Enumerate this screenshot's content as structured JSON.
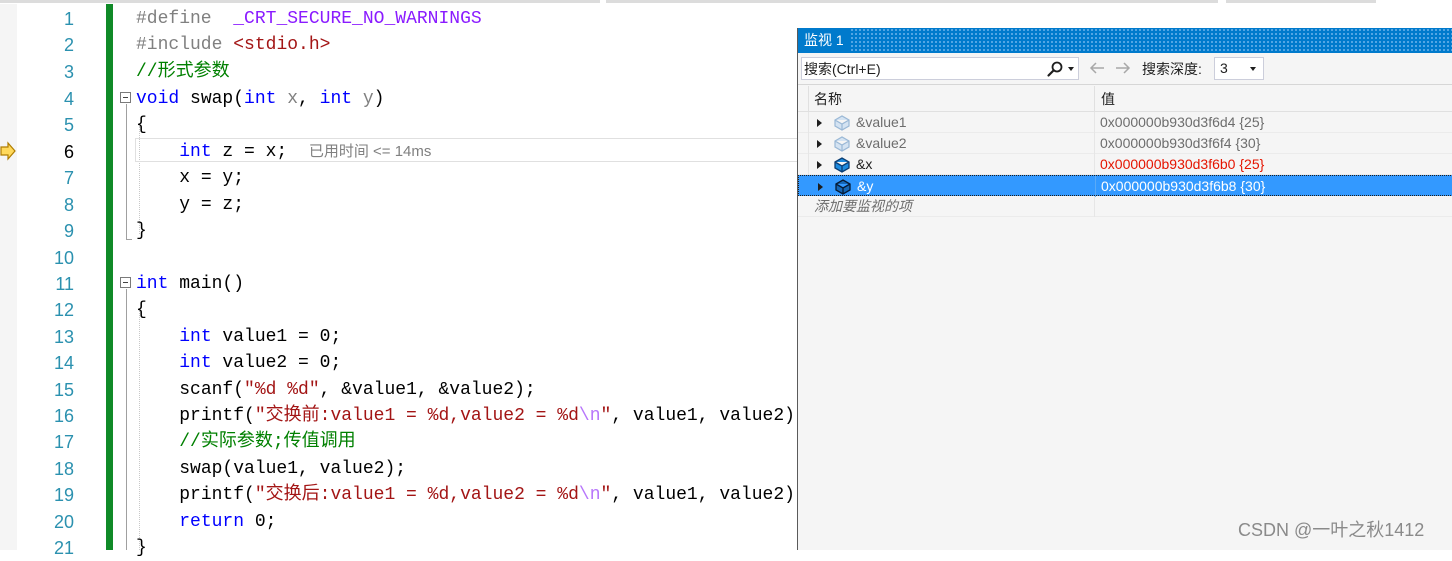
{
  "editor": {
    "line_numbers": [
      "1",
      "2",
      "3",
      "4",
      "5",
      "6",
      "7",
      "8",
      "9",
      "10",
      "11",
      "12",
      "13",
      "14",
      "15",
      "16",
      "17",
      "18",
      "19",
      "20",
      "21"
    ],
    "current_line": 6,
    "lines": {
      "l1": {
        "kw": "#define",
        "mac": "_CRT_SECURE_NO_WARNINGS"
      },
      "l2": {
        "kw": "#include",
        "hdr": "<stdio.h>"
      },
      "l3": {
        "comment": "//形式参数"
      },
      "l4": {
        "kw1": "void",
        "fn": " swap(",
        "kw2": "int",
        "p1": " x",
        "sep": ", ",
        "kw3": "int",
        "p2": " y",
        "end": ")"
      },
      "l5": {
        "text": "{"
      },
      "l6": {
        "kw": "int",
        "rest": " z = x;",
        "elapsed": "已用时间 <= 14ms"
      },
      "l7": {
        "text": "x = y;"
      },
      "l8": {
        "text": "y = z;"
      },
      "l9": {
        "text": "}"
      },
      "l11": {
        "kw": "int",
        "rest": " main()"
      },
      "l12": {
        "text": "{"
      },
      "l13": {
        "kw": "int",
        "rest": " value1 = 0;"
      },
      "l14": {
        "kw": "int",
        "rest": " value2 = 0;"
      },
      "l15": {
        "fn": "scanf(",
        "str": "\"%d %d\"",
        "rest": ", &value1, &value2);"
      },
      "l16": {
        "fn": "printf(",
        "str1": "\"交换前:value1 = %d,value2 = %d",
        "esc": "\\n",
        "str2": "\"",
        "rest": ", value1, value2)"
      },
      "l17": {
        "comment": "//实际参数;传值调用"
      },
      "l18": {
        "text": "swap(value1, value2);"
      },
      "l19": {
        "fn": "printf(",
        "str1": "\"交换后:value1 = %d,value2 = %d",
        "esc": "\\n",
        "str2": "\"",
        "rest": ", value1, value2)"
      },
      "l20": {
        "kw": "return",
        "rest": " 0;"
      },
      "l21": {
        "text": "}"
      }
    }
  },
  "watch": {
    "title": "监视 1",
    "search_placeholder": "搜索(Ctrl+E)",
    "depth_label": "搜索深度:",
    "depth_value": "3",
    "col_name": "名称",
    "col_value": "值",
    "rows": [
      {
        "name": "&value1",
        "value": "0x000000b930d3f6d4 {25}"
      },
      {
        "name": "&value2",
        "value": "0x000000b930d3f6f4 {30}"
      },
      {
        "name": "&x",
        "value": "0x000000b930d3f6b0 {25}"
      },
      {
        "name": "&y",
        "value": "0x000000b930d3f6b8 {30}"
      }
    ],
    "add_item": "添加要监视的项"
  },
  "watermark": "CSDN @一叶之秋1412",
  "colors": {
    "accent": "#007acc",
    "selection": "#3399ff",
    "changed": "#e51400",
    "change_bar": "#108a28"
  }
}
